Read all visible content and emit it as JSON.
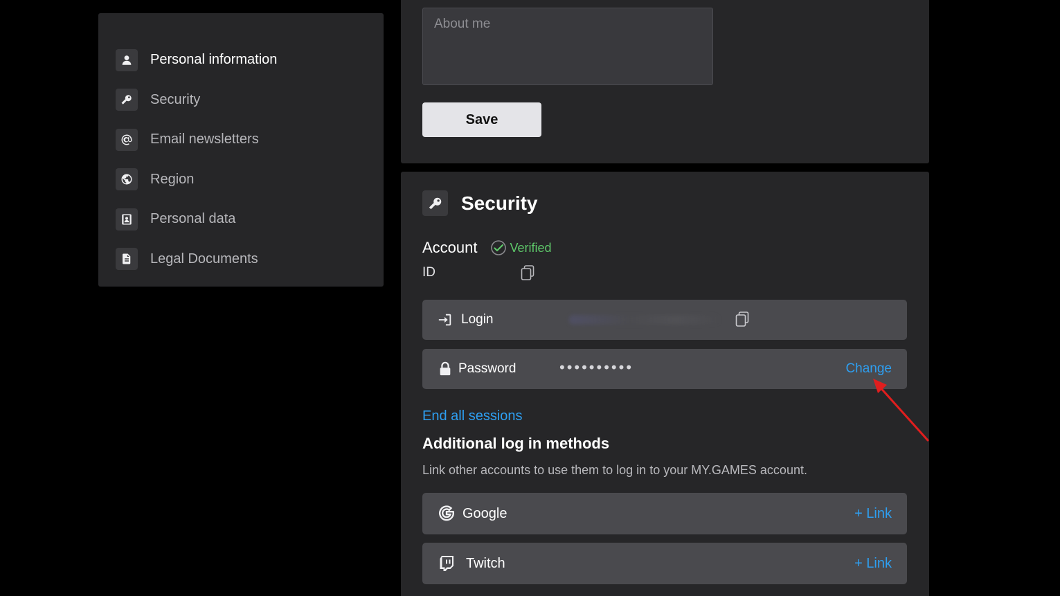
{
  "sidebar": {
    "items": [
      {
        "label": "Personal information",
        "icon": "user-icon",
        "active": true
      },
      {
        "label": "Security",
        "icon": "key-icon",
        "active": false
      },
      {
        "label": "Email newsletters",
        "icon": "at-icon",
        "active": false
      },
      {
        "label": "Region",
        "icon": "globe-icon",
        "active": false
      },
      {
        "label": "Personal data",
        "icon": "id-card-icon",
        "active": false
      },
      {
        "label": "Legal Documents",
        "icon": "document-icon",
        "active": false
      }
    ]
  },
  "profile": {
    "about_placeholder": "About me",
    "save_label": "Save"
  },
  "security": {
    "title": "Security",
    "account_label": "Account",
    "verified_label": "Verified",
    "id_label": "ID",
    "login_label": "Login",
    "password_label": "Password",
    "password_mask": "••••••••••",
    "change_label": "Change",
    "end_sessions_label": "End all sessions",
    "additional_title": "Additional log in methods",
    "additional_desc": "Link other accounts to use them to log in to your MY.GAMES account.",
    "methods": [
      {
        "label": "Google",
        "action": "+ Link"
      },
      {
        "label": "Twitch",
        "action": "+ Link"
      }
    ]
  },
  "colors": {
    "accent_link": "#2e9ff1",
    "verified": "#5ec86a",
    "panel_bg": "#262628",
    "row_bg": "#4a4a4e",
    "annotation_arrow": "#e01e1e"
  }
}
